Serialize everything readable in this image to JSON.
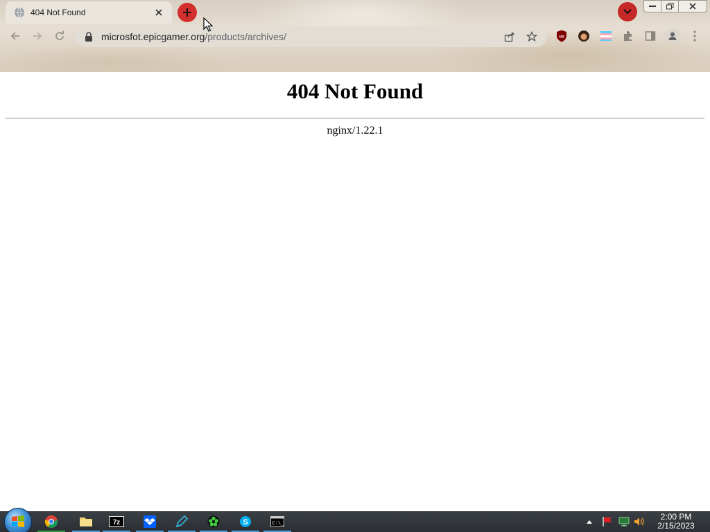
{
  "browser": {
    "tab": {
      "title": "404 Not Found"
    },
    "address_bar": {
      "host": "microsfot.epicgamer.org",
      "path": "/products/archives/"
    },
    "accent_color": "#d32f2f"
  },
  "page": {
    "heading": "404 Not Found",
    "server_signature": "nginx/1.22.1"
  },
  "taskbar": {
    "apps": [
      "chrome-icon",
      "file-explorer-icon",
      "7zip-icon",
      "dropbox-icon",
      "pen-app-icon",
      "green-app-icon",
      "skype-icon",
      "cmd-icon"
    ],
    "clock": {
      "time": "2:00 PM",
      "date": "2/15/2023"
    }
  }
}
